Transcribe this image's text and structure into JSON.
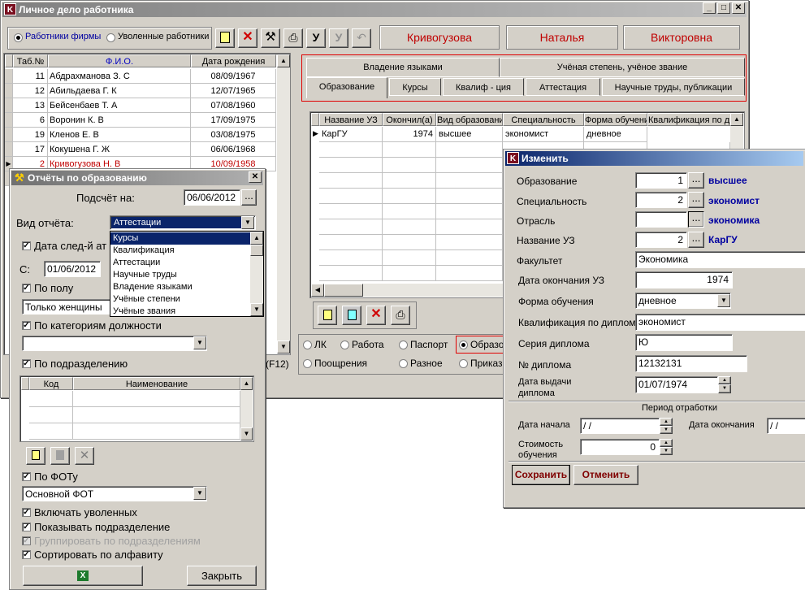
{
  "main": {
    "title": "Личное дело работника",
    "radio_staff": "Работники фирмы",
    "radio_fired": "Уволенные работники",
    "name_last": "Кривогузова",
    "name_first": "Наталья",
    "name_middle": "Викторовна",
    "table_headers": [
      "Таб.№",
      "Ф.И.О.",
      "Дата рождения"
    ],
    "rows": [
      {
        "tab": "11",
        "name": "Абдрахманова З. С",
        "date": "08/09/1967"
      },
      {
        "tab": "12",
        "name": "Абильдаева Г. К",
        "date": "12/07/1965"
      },
      {
        "tab": "13",
        "name": "Бейсенбаев Т. А",
        "date": "07/08/1960"
      },
      {
        "tab": "6",
        "name": "Воронин К. В",
        "date": "17/09/1975"
      },
      {
        "tab": "19",
        "name": "Кленов Е. В",
        "date": "03/08/1975"
      },
      {
        "tab": "17",
        "name": "Кокушена Г. Ж",
        "date": "06/06/1968"
      },
      {
        "tab": "2",
        "name": "Кривогузова Н. В",
        "date": "10/09/1958"
      }
    ],
    "f12_label": "(F12)",
    "tabs_top": [
      "Владение языками",
      "Учёная степень, учёное звание"
    ],
    "tabs_bottom": [
      "Образование",
      "Курсы",
      "Квалиф - ция",
      "Аттестация",
      "Научные труды, публикации"
    ],
    "edu_headers": [
      "Название УЗ",
      "Окончил(а)",
      "Вид образования",
      "Специальность",
      "Форма обучения",
      "Квалификация по диплому"
    ],
    "edu_row": {
      "uz": "КарГУ",
      "year": "1974",
      "kind": "высшее",
      "spec": "экономист",
      "form": "дневное"
    },
    "bottom_radios": [
      "ЛК",
      "Работа",
      "Паспорт",
      "Образо",
      "Поощрения",
      "Разное",
      "Приказы"
    ]
  },
  "reports": {
    "title": "Отчёты по образованию",
    "count_on_label": "Подсчёт на:",
    "count_on_value": "06/06/2012",
    "report_type_label": "Вид отчёта:",
    "report_type_value": "Аттестации",
    "dropdown_options": [
      "Курсы",
      "Квалификация",
      "Аттестации",
      "Научные труды",
      "Владение языками",
      "Учёные степени",
      "Учёные звания"
    ],
    "next_date_label": "Дата след-й ат",
    "from_label": "С:",
    "from_value": "01/06/2012",
    "by_gender_label": "По полу",
    "gender_value": "Только женщины",
    "by_position_label": "По категориям должности",
    "by_dept_label": "По подразделению",
    "dept_headers": [
      "Код",
      "Наименование"
    ],
    "by_fot_label": "По ФОТу",
    "fot_value": "Основной ФОТ",
    "include_fired": "Включать уволенных",
    "show_dept": "Показывать подразделение",
    "group_dept": "Группировать по подразделениям",
    "sort_alpha": "Сортировать по алфавиту",
    "close_label": "Закрыть"
  },
  "edit": {
    "title": "Изменить",
    "education_label": "Образование",
    "education_code": "1",
    "education_value": "высшее",
    "specialty_label": "Специальность",
    "specialty_code": "2",
    "specialty_value": "экономист",
    "industry_label": "Отрасль",
    "industry_code": "",
    "industry_value": "экономика",
    "uz_label": "Название УЗ",
    "uz_code": "2",
    "uz_value": "КарГУ",
    "faculty_label": "Факультет",
    "faculty_value": "Экономика",
    "grad_date_label": "Дата окончания УЗ",
    "grad_date_value": "1974",
    "form_label": "Форма обучения",
    "form_value": "дневное",
    "qual_label": "Квалификация по диплому",
    "qual_value": "экономист",
    "series_label": "Серия диплома",
    "series_value": "Ю",
    "number_label": "№ диплома",
    "number_value": "12132131",
    "issue_label_1": "Дата выдачи",
    "issue_label_2": "диплома",
    "issue_value": "01/07/1974",
    "period_title": "Период отработки",
    "start_label": "Дата начала",
    "start_value": " / /",
    "end_label": "Дата окончания",
    "end_value": " / /",
    "cost_label_1": "Стоимость",
    "cost_label_2": "обучения",
    "cost_value": "0",
    "save_label": "Сохранить",
    "cancel_label": "Отменить"
  },
  "colors": {
    "accent_red": "#c00000",
    "title_blue": "#0a246a",
    "row_selected_text": "#c00000",
    "value_blue": "#0000a0"
  }
}
